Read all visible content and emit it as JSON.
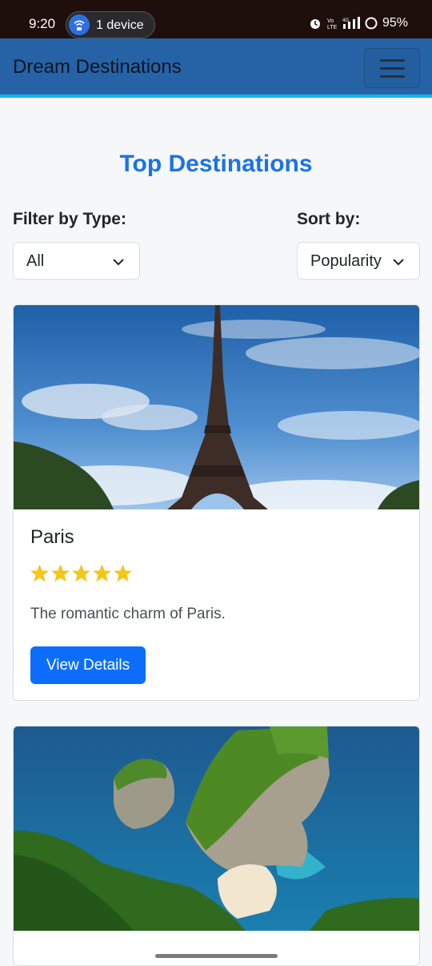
{
  "status_bar": {
    "time": "9:20",
    "device_label": "1 device",
    "battery": "95%"
  },
  "navbar": {
    "brand": "Dream Destinations",
    "menu_icon": "hamburger-icon"
  },
  "page": {
    "title": "Top Destinations",
    "filter_label": "Filter by Type:",
    "sort_label": "Sort by:",
    "filter_value": "All",
    "sort_value": "Popularity"
  },
  "cards": [
    {
      "title": "Paris",
      "rating": 5,
      "description": "The romantic charm of Paris.",
      "button": "View Details",
      "image": "eiffel-tower-photo"
    },
    {
      "image": "coastal-cliff-photo"
    }
  ],
  "colors": {
    "navbar": "#2563a6",
    "accent_line": "#18b4e8",
    "title": "#1a73e8",
    "button": "#0d6efd",
    "star": "#f5c518"
  }
}
